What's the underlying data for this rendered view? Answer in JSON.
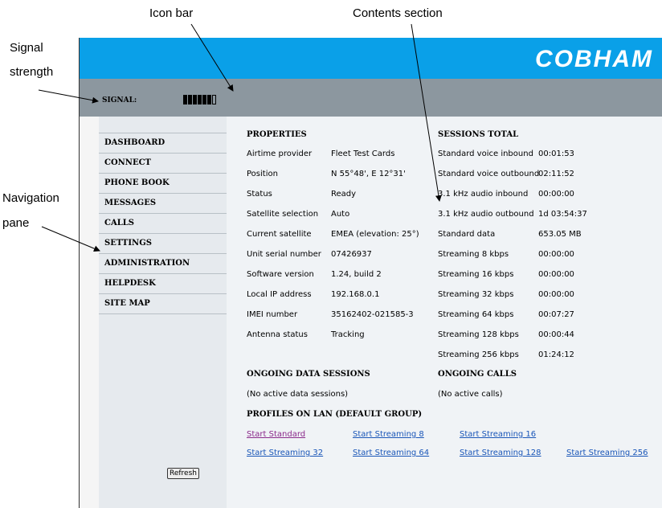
{
  "callouts": {
    "icon_bar": "Icon bar",
    "contents_section": "Contents section",
    "signal_strength_line1": "Signal",
    "signal_strength_line2": "strength",
    "navigation_pane_line1": "Navigation",
    "navigation_pane_line2": "pane"
  },
  "brand": "COBHAM",
  "signal": {
    "label": "SIGNAL:",
    "filled_bars": 6,
    "total_bars": 7
  },
  "nav": {
    "items": [
      {
        "label": "DASHBOARD"
      },
      {
        "label": "CONNECT"
      },
      {
        "label": "PHONE BOOK"
      },
      {
        "label": "MESSAGES"
      },
      {
        "label": "CALLS"
      },
      {
        "label": "SETTINGS"
      },
      {
        "label": "ADMINISTRATION"
      },
      {
        "label": "HELPDESK"
      },
      {
        "label": "SITE MAP"
      }
    ]
  },
  "properties": {
    "title": "PROPERTIES",
    "rows": [
      {
        "label": "Airtime provider",
        "value": "Fleet Test Cards"
      },
      {
        "label": "Position",
        "value": "N 55°48', E 12°31'"
      },
      {
        "label": "Status",
        "value": "Ready"
      },
      {
        "label": "Satellite selection",
        "value": "Auto"
      },
      {
        "label": "Current satellite",
        "value": "EMEA (elevation: 25°)"
      },
      {
        "label": "Unit serial number",
        "value": "07426937"
      },
      {
        "label": "Software version",
        "value": "1.24, build 2"
      },
      {
        "label": "Local IP address",
        "value": "192.168.0.1"
      },
      {
        "label": "IMEI number",
        "value": "35162402-021585-3"
      },
      {
        "label": "Antenna status",
        "value": "Tracking"
      }
    ]
  },
  "sessions": {
    "title": "SESSIONS TOTAL",
    "rows": [
      {
        "label": "Standard voice inbound",
        "value": "00:01:53"
      },
      {
        "label": "Standard voice outbound",
        "value": "02:11:52"
      },
      {
        "label": "3.1 kHz audio inbound",
        "value": "00:00:00"
      },
      {
        "label": "3.1 kHz audio outbound",
        "value": "1d 03:54:37"
      },
      {
        "label": "Standard data",
        "value": "653.05 MB"
      },
      {
        "label": "Streaming 8 kbps",
        "value": "00:00:00"
      },
      {
        "label": "Streaming 16 kbps",
        "value": "00:00:00"
      },
      {
        "label": "Streaming 32 kbps",
        "value": "00:00:00"
      },
      {
        "label": "Streaming 64 kbps",
        "value": "00:07:27"
      },
      {
        "label": "Streaming 128 kbps",
        "value": "00:00:44"
      },
      {
        "label": "Streaming 256 kbps",
        "value": "01:24:12"
      }
    ]
  },
  "ongoing_data": {
    "title": "ONGOING DATA SESSIONS",
    "text": "(No active data sessions)"
  },
  "ongoing_calls": {
    "title": "ONGOING CALLS",
    "text": "(No active calls)"
  },
  "profiles": {
    "title": "PROFILES ON LAN (DEFAULT GROUP)",
    "links": [
      "Start Standard",
      "Start Streaming 8",
      "Start Streaming 16",
      "Start Streaming 32",
      "Start Streaming 64",
      "Start Streaming 128",
      "Start Streaming 256"
    ]
  },
  "refresh_label": "Refresh",
  "colors": {
    "header_blue": "#0aa0e8",
    "iconbar_gray": "#8c979f",
    "link_blue": "#1a56b8",
    "visited_link": "#8b2a8b"
  }
}
